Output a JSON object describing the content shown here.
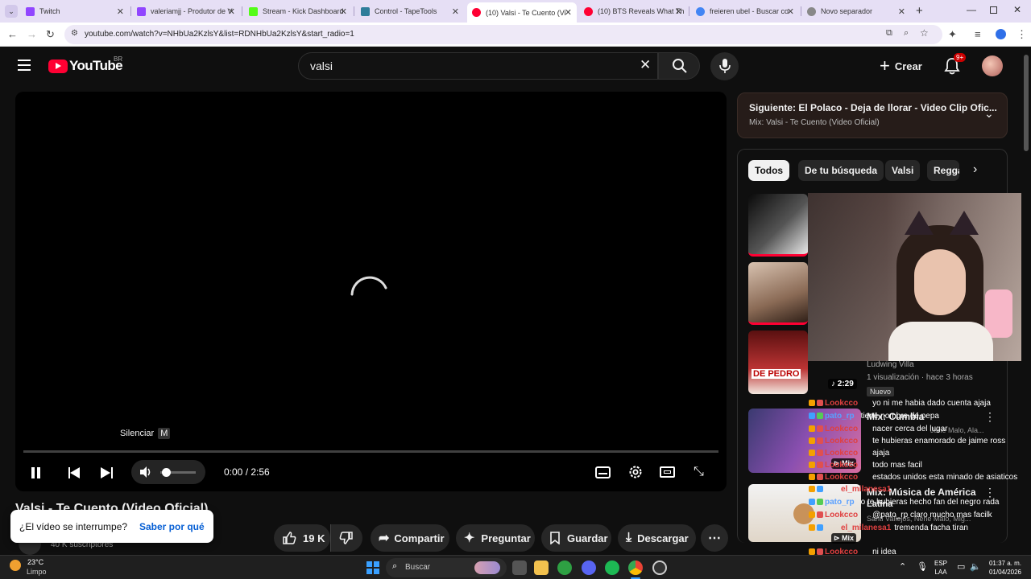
{
  "browser": {
    "tabs": [
      {
        "label": "Twitch",
        "color": "#9146ff",
        "active": false
      },
      {
        "label": "valeriamjj - Produtor de V",
        "color": "#9146ff",
        "active": false
      },
      {
        "label": "Stream - Kick Dashboard",
        "color": "#53fc18",
        "active": false
      },
      {
        "label": "Control - TapeTools",
        "color": "#2e7d9a",
        "active": false
      },
      {
        "label": "(10) Valsi - Te Cuento (Vi",
        "color": "#ff0033",
        "active": true
      },
      {
        "label": "(10) BTS Reveals What Th",
        "color": "#ff0033",
        "active": false
      },
      {
        "label": "freieren ubel - Buscar co",
        "color": "#4285f4",
        "active": false
      },
      {
        "label": "Novo separador",
        "color": "#888888",
        "active": false
      }
    ],
    "url": "youtube.com/watch?v=NHbUa2KzlsY&list=RDNHbUa2KzlsY&start_radio=1"
  },
  "youtube": {
    "logo_text": "YouTube",
    "region": "BR",
    "search_value": "valsi",
    "create_label": "Crear",
    "notification_count": "9+"
  },
  "player": {
    "tooltip_label": "Silenciar",
    "tooltip_key": "M",
    "time": "0:00 / 2:56"
  },
  "video": {
    "title": "Valsi - Te Cuento (Video Oficial)",
    "subscribers": "40 K suscriptores",
    "likes": "19 K",
    "share_label": "Compartir",
    "ask_label": "Preguntar",
    "save_label": "Guardar",
    "download_label": "Descargar"
  },
  "toast": {
    "question": "¿El vídeo se interrumpe?",
    "link": "Saber por qué"
  },
  "up_next": {
    "label": "Siguiente: El Polaco - Deja de llorar - Video Clip Ofic...",
    "sub": "Mix: Valsi - Te Cuento (Video Oficial)"
  },
  "chips": [
    "Todos",
    "De tu búsqueda",
    "Valsi",
    "Regga"
  ],
  "recommendations": [
    {
      "meta_channel": "Ludwing Villa",
      "meta_views": "1 visualización · hace 3 horas",
      "badge": "Nuevo",
      "duration": "2:29"
    },
    {
      "title": "Mix: Cumbia",
      "subtitle": "Jane Malo, Ala...",
      "mix_label": "Mix"
    },
    {
      "title": "Mix: Música de América",
      "subtitle": "Latina",
      "extra": "Santi Vallejos, Nene Malo, Mig...",
      "mix_label": "Mix"
    }
  ],
  "stream_thumb_text": "DE PEDRO",
  "chat": [
    {
      "user": "Lookcco",
      "msg": "yo ni me habia dado cuenta ajaja"
    },
    {
      "user": "pato_rp",
      "msg": "tiene nombre de pepa"
    },
    {
      "user": "Lookcco",
      "msg": "nacer cerca del lugar"
    },
    {
      "user": "Lookcco",
      "msg": "te hubieras enamorado de jaime ross"
    },
    {
      "user": "Lookcco",
      "msg": "ajaja"
    },
    {
      "user": "Lookcco",
      "msg": "todo mas facil"
    },
    {
      "user": "Lookcco",
      "msg": "estados unidos esta minado de asiaticos"
    },
    {
      "user": "el_milanesa1",
      "msg": ""
    },
    {
      "user": "pato_rp",
      "msg": "o te hubieras hecho fan del negro rada"
    },
    {
      "user": "Lookcco",
      "msg": "@pato_rp claro mucho mas facilk"
    },
    {
      "user": "el_milanesa1",
      "msg": "tremenda facha tiran"
    },
    {
      "user": "Lookcco",
      "msg": "ni idea"
    }
  ],
  "taskbar": {
    "temp": "23°C",
    "weather": "Limpo",
    "search_label": "Buscar",
    "lang": "ESP",
    "lang2": "LAA",
    "time": "01:37 a. m.",
    "date": "01/04/2026"
  },
  "colors": {
    "yt_red": "#ff0033",
    "link_blue": "#3ea6ff",
    "chat_red": "#e04040"
  }
}
